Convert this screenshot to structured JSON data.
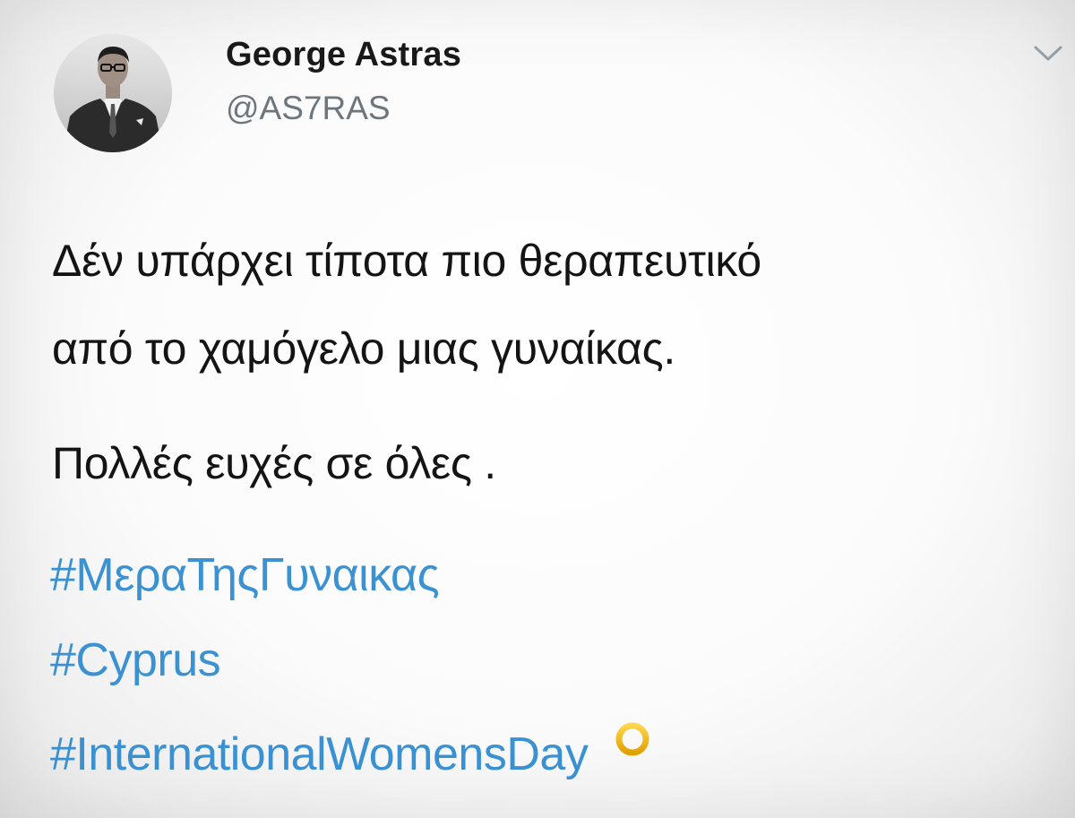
{
  "tweet": {
    "author": {
      "display_name": "George Astras",
      "handle": "@AS7RAS"
    },
    "body_lines": [
      "Δέν υπάρχει τίποτα πιο θεραπευτικό",
      "από το χαμόγελο μιας γυναίκας.",
      "Πολλές ευχές σε όλες ."
    ],
    "hashtags": [
      "#ΜεραΤηςΓυναικας",
      "#Cyprus",
      "#InternationalWomensDay"
    ],
    "emoji_icon": "female-sign-icon"
  },
  "colors": {
    "hashtag": "#3a92d3",
    "handle": "#6e767d",
    "text": "#141414",
    "emoji": "#f2b705"
  }
}
